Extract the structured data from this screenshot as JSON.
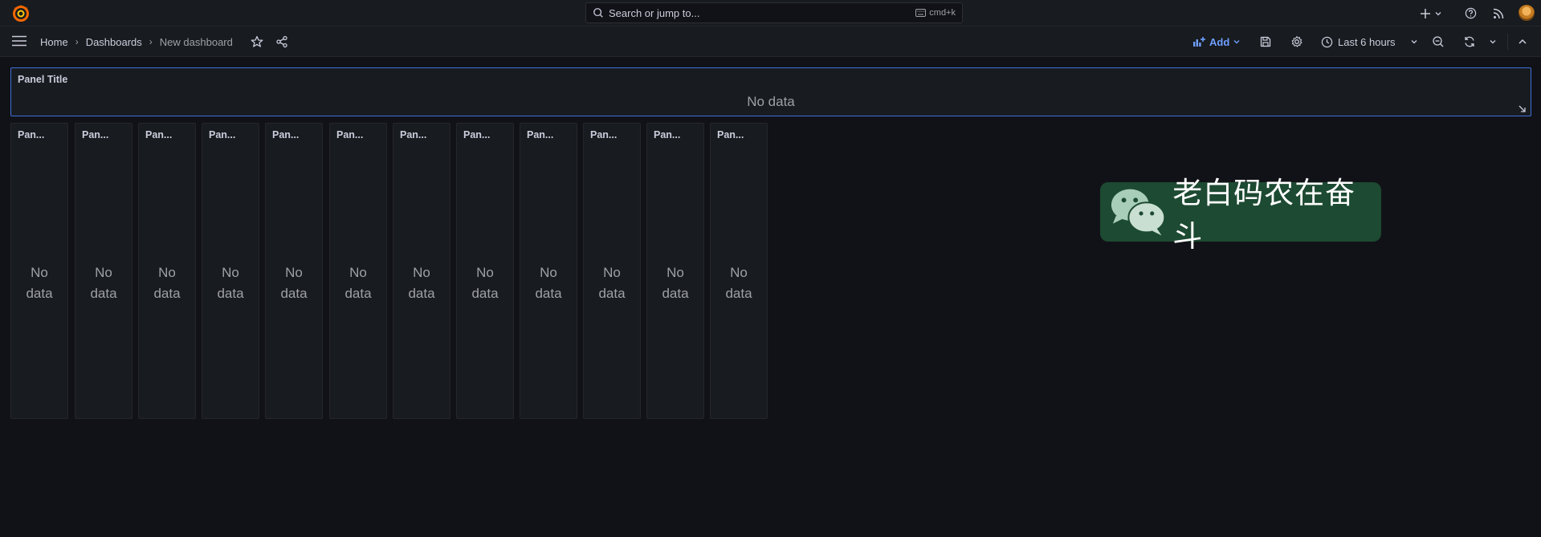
{
  "topbar": {
    "search_placeholder": "Search or jump to...",
    "search_shortcut": "cmd+k"
  },
  "navbar": {
    "breadcrumbs": [
      "Home",
      "Dashboards",
      "New dashboard"
    ],
    "separator": "›",
    "add_label": "Add",
    "time_range": "Last 6 hours"
  },
  "wide_panel": {
    "title": "Panel Title",
    "no_data": "No data"
  },
  "panels": [
    {
      "title": "Pan...",
      "no_data": "No data"
    },
    {
      "title": "Pan...",
      "no_data": "No data"
    },
    {
      "title": "Pan...",
      "no_data": "No data"
    },
    {
      "title": "Pan...",
      "no_data": "No data"
    },
    {
      "title": "Pan...",
      "no_data": "No data"
    },
    {
      "title": "Pan...",
      "no_data": "No data"
    },
    {
      "title": "Pan...",
      "no_data": "No data"
    },
    {
      "title": "Pan...",
      "no_data": "No data"
    },
    {
      "title": "Pan...",
      "no_data": "No data"
    },
    {
      "title": "Pan...",
      "no_data": "No data"
    },
    {
      "title": "Pan...",
      "no_data": "No data"
    },
    {
      "title": "Pan...",
      "no_data": "No data"
    }
  ],
  "watermark": {
    "text": "老白码农在奋斗"
  },
  "colors": {
    "background": "#111217",
    "bar": "#181b1f",
    "accent_blue": "#6e9fff",
    "selected_border": "#3d71d9",
    "logo_orange": "#f46800",
    "watermark_green": "#1d4a32"
  },
  "icons": {
    "logo": "grafana-logo-icon",
    "search": "search-icon",
    "keyboard": "keyboard-icon",
    "plus": "plus-icon",
    "help": "help-icon",
    "news": "rss-icon",
    "menu": "hamburger-icon",
    "star": "star-icon",
    "share": "share-icon",
    "save": "save-icon",
    "settings": "gear-icon",
    "clock": "clock-icon",
    "zoom_out": "zoom-out-icon",
    "refresh": "refresh-icon",
    "collapse": "chevron-up-icon"
  }
}
